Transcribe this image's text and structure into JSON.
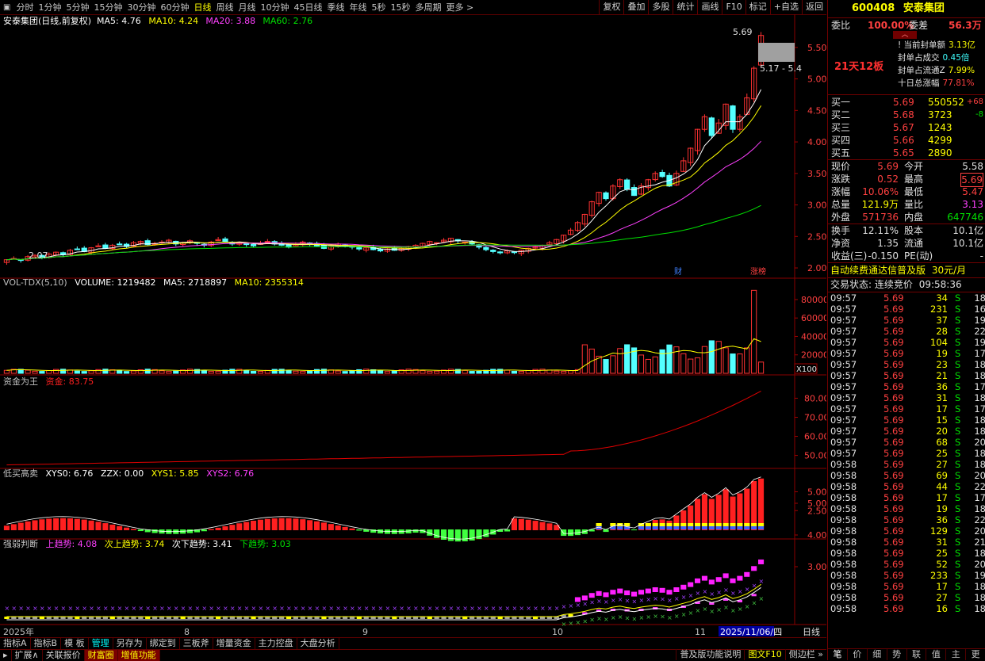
{
  "toolbar": {
    "periods": [
      "分时",
      "1分钟",
      "5分钟",
      "15分钟",
      "30分钟",
      "60分钟",
      "日线",
      "周线",
      "月线",
      "10分钟",
      "45日线",
      "季线",
      "年线",
      "5秒",
      "15秒",
      "多周期",
      "更多 >"
    ],
    "active": "日线",
    "right": [
      "复权",
      "叠加",
      "多股",
      "统计",
      "画线",
      "F10",
      "标记",
      "+自选",
      "返回"
    ]
  },
  "main_panel": {
    "title": "安泰集团(日线,前复权)",
    "ma": [
      {
        "label": "MA5: 4.76",
        "color": "#ffffff"
      },
      {
        "label": "MA10: 4.24",
        "color": "#ffff00"
      },
      {
        "label": "MA20: 3.88",
        "color": "#ff40ff"
      },
      {
        "label": "MA60: 2.76",
        "color": "#00e000"
      }
    ],
    "price_high_label": "5.69",
    "price_range_label": "5.17 - 5.4",
    "price_low_label": "2.07",
    "axis": [
      "5.50",
      "5.00",
      "4.50",
      "4.00",
      "3.50",
      "3.00",
      "2.50",
      "2.00"
    ],
    "event_tags": [
      "财",
      "涨榜"
    ]
  },
  "volume_panel": {
    "title": "VOL-TDX(5,10)",
    "volume": "VOLUME: 1219482",
    "ma5": "MA5: 2718897",
    "ma10": "MA10: 2355314",
    "axis": [
      "80000",
      "60000",
      "40000",
      "20000"
    ],
    "unit": "X100"
  },
  "fund_panel": {
    "title": "资金为王",
    "value": "资金: 83.75",
    "axis": [
      "80.00",
      "70.00",
      "60.00",
      "50.00"
    ]
  },
  "buysell_panel": {
    "title": "低买高卖",
    "xys0": "XYS0: 6.76",
    "zzx": "ZZX: 0.00",
    "xys1": "XYS1: 5.85",
    "xys2": "XYS2: 6.76",
    "axis": [
      "5.00",
      "2.50"
    ]
  },
  "strength_panel": {
    "title": "强弱判断",
    "up": "上趋势: 4.08",
    "up2": "次上趋势: 3.74",
    "down2": "次下趋势: 3.41",
    "down": "下趋势: 3.03",
    "axis": [
      "5.00",
      "4.00",
      "3.00"
    ]
  },
  "time_axis": {
    "labels": [
      "2025年",
      "8",
      "9",
      "10",
      "11"
    ],
    "date_box": "2025/11/06/四",
    "period": "日线"
  },
  "bottom": {
    "tabs": [
      "指标A",
      "指标B",
      "模 板",
      "管理",
      "另存为",
      "绑定到",
      "三板斧",
      "增量资金",
      "主力控盘",
      "大盘分析"
    ],
    "active_tab": "管理",
    "tabs2": [
      "扩展∧",
      "关联报价",
      "财富圈",
      "增值功能"
    ],
    "status": "普及版功能说明",
    "f10": "图文F10",
    "side": "侧边栏 »"
  },
  "quote": {
    "code": "600408",
    "name": "安泰集团",
    "wei_bi_label": "委比",
    "wei_bi": "100.00%",
    "wei_cha_label": "委差",
    "wei_cha": "56.3万",
    "board": "21天12板",
    "seal_items": [
      {
        "label": "当前封单额",
        "value": "3.13亿"
      },
      {
        "label": "封单占成交",
        "value": "0.45倍"
      },
      {
        "label": "封单占流通Z",
        "value": "7.99%"
      },
      {
        "label": "十日总涨幅",
        "value": "77.81%"
      }
    ],
    "bids": [
      {
        "label": "买一",
        "price": "5.69",
        "vol": "550552",
        "chg": "+68"
      },
      {
        "label": "买二",
        "price": "5.68",
        "vol": "3723",
        "chg": "-8"
      },
      {
        "label": "买三",
        "price": "5.67",
        "vol": "1243",
        "chg": ""
      },
      {
        "label": "买四",
        "price": "5.66",
        "vol": "4299",
        "chg": ""
      },
      {
        "label": "买五",
        "price": "5.65",
        "vol": "2890",
        "chg": ""
      }
    ],
    "stats": [
      {
        "l1": "现价",
        "v1": "5.69",
        "l2": "今开",
        "v2": "5.58"
      },
      {
        "l1": "涨跌",
        "v1": "0.52",
        "l2": "最高",
        "v2": "5.69"
      },
      {
        "l1": "涨幅",
        "v1": "10.06%",
        "l2": "最低",
        "v2": "5.47"
      },
      {
        "l1": "总量",
        "v1": "121.9万",
        "l2": "量比",
        "v2": "3.13"
      },
      {
        "l1": "外盘",
        "v1": "571736",
        "l2": "内盘",
        "v2": "647746"
      }
    ],
    "stats2": [
      {
        "l1": "换手",
        "v1": "12.11%",
        "l2": "股本",
        "v2": "10.1亿"
      },
      {
        "l1": "净资",
        "v1": "1.35",
        "l2": "流通",
        "v2": "10.1亿"
      },
      {
        "l1": "收益(三)",
        "v1": "-0.150",
        "l2": "PE(动)",
        "v2": "-"
      }
    ],
    "promo": "自动续费通达信普及版",
    "promo_price": "30元/月",
    "trade_state_label": "交易状态: 连续竞价",
    "trade_time": "09:58:36",
    "ticks": [
      [
        "09:57",
        "5.69",
        "34",
        "S",
        "18"
      ],
      [
        "09:57",
        "5.69",
        "231",
        "S",
        "16"
      ],
      [
        "09:57",
        "5.69",
        "37",
        "S",
        "19"
      ],
      [
        "09:57",
        "5.69",
        "28",
        "S",
        "22"
      ],
      [
        "09:57",
        "5.69",
        "104",
        "S",
        "19"
      ],
      [
        "09:57",
        "5.69",
        "19",
        "S",
        "17"
      ],
      [
        "09:57",
        "5.69",
        "23",
        "S",
        "18"
      ],
      [
        "09:57",
        "5.69",
        "21",
        "S",
        "18"
      ],
      [
        "09:57",
        "5.69",
        "36",
        "S",
        "17"
      ],
      [
        "09:57",
        "5.69",
        "31",
        "S",
        "18"
      ],
      [
        "09:57",
        "5.69",
        "17",
        "S",
        "17"
      ],
      [
        "09:57",
        "5.69",
        "15",
        "S",
        "18"
      ],
      [
        "09:57",
        "5.69",
        "20",
        "S",
        "18"
      ],
      [
        "09:57",
        "5.69",
        "68",
        "S",
        "20"
      ],
      [
        "09:57",
        "5.69",
        "25",
        "S",
        "18"
      ],
      [
        "09:58",
        "5.69",
        "27",
        "S",
        "18"
      ],
      [
        "09:58",
        "5.69",
        "69",
        "S",
        "20"
      ],
      [
        "09:58",
        "5.69",
        "44",
        "S",
        "22"
      ],
      [
        "09:58",
        "5.69",
        "17",
        "S",
        "17"
      ],
      [
        "09:58",
        "5.69",
        "19",
        "S",
        "18"
      ],
      [
        "09:58",
        "5.69",
        "36",
        "S",
        "22"
      ],
      [
        "09:58",
        "5.69",
        "129",
        "S",
        "20"
      ],
      [
        "09:58",
        "5.69",
        "31",
        "S",
        "21"
      ],
      [
        "09:58",
        "5.69",
        "25",
        "S",
        "18"
      ],
      [
        "09:58",
        "5.69",
        "52",
        "S",
        "20"
      ],
      [
        "09:58",
        "5.69",
        "233",
        "S",
        "19"
      ],
      [
        "09:58",
        "5.69",
        "17",
        "S",
        "18"
      ],
      [
        "09:58",
        "5.69",
        "27",
        "S",
        "18"
      ],
      [
        "09:58",
        "5.69",
        "16",
        "S",
        "18"
      ]
    ],
    "tabs": [
      "笔",
      "价",
      "细",
      "势",
      "联",
      "值",
      "主",
      "更"
    ]
  },
  "chart_data": {
    "type": "candlestick",
    "price_ylim": [
      1.9,
      5.85
    ],
    "candles_close": [
      2.13,
      2.15,
      2.12,
      2.18,
      2.2,
      2.16,
      2.22,
      2.25,
      2.21,
      2.28,
      2.3,
      2.26,
      2.32,
      2.35,
      2.31,
      2.36,
      2.38,
      2.34,
      2.4,
      2.42,
      2.37,
      2.39,
      2.41,
      2.44,
      2.38,
      2.4,
      2.43,
      2.39,
      2.36,
      2.41,
      2.45,
      2.42,
      2.38,
      2.4,
      2.37,
      2.35,
      2.39,
      2.42,
      2.38,
      2.36,
      2.33,
      2.37,
      2.41,
      2.38,
      2.35,
      2.31,
      2.34,
      2.38,
      2.36,
      2.33,
      2.3,
      2.32,
      2.29,
      2.27,
      2.3,
      2.28,
      2.31,
      2.34,
      2.36,
      2.39,
      2.42,
      2.4,
      2.44,
      2.47,
      2.43,
      2.41,
      2.38,
      2.33,
      2.29,
      2.26,
      2.24,
      2.27,
      2.25,
      2.28,
      2.31,
      2.33,
      2.36,
      2.4,
      2.45,
      2.52,
      2.6,
      2.72,
      2.85,
      3.05,
      3.2,
      3.1,
      3.3,
      3.4,
      3.25,
      3.15,
      3.3,
      3.4,
      3.5,
      3.45,
      3.3,
      3.5,
      3.7,
      3.9,
      4.2,
      4.4,
      4.1,
      4.3,
      4.6,
      4.2,
      4.4,
      4.7,
      5.17,
      5.69
    ],
    "ma_series": [
      "MA5",
      "MA10",
      "MA20",
      "MA60"
    ],
    "ma_last": [
      4.76,
      4.24,
      3.88,
      2.76
    ],
    "volume_ylim": [
      0,
      92000
    ],
    "volume_last": 12194,
    "fund_ylim": [
      44,
      86
    ],
    "fund_last": 83.75
  }
}
